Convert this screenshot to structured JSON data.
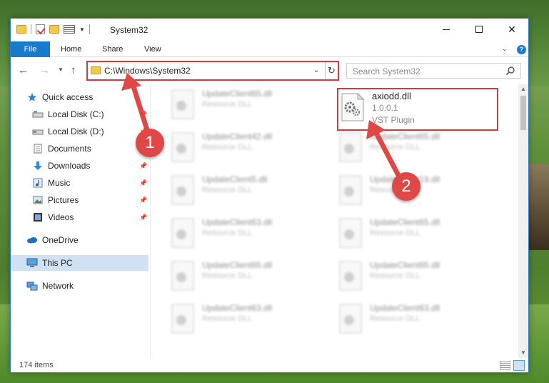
{
  "window": {
    "title": "System32",
    "min_label": "",
    "max_label": "",
    "close_label": "✕"
  },
  "ribbon": {
    "tabs": [
      "File",
      "Home",
      "Share",
      "View"
    ]
  },
  "address": {
    "path": "C:\\Windows\\System32",
    "search_placeholder": "Search System32"
  },
  "sidebar": {
    "items": [
      {
        "label": "Quick access",
        "icon": "star-icon",
        "pinned": false
      },
      {
        "label": "Local Disk (C:)",
        "icon": "drive-icon",
        "pinned": true
      },
      {
        "label": "Local Disk (D:)",
        "icon": "drive-icon",
        "pinned": true
      },
      {
        "label": "Documents",
        "icon": "document-icon",
        "pinned": true
      },
      {
        "label": "Downloads",
        "icon": "download-icon",
        "pinned": true
      },
      {
        "label": "Music",
        "icon": "music-icon",
        "pinned": true
      },
      {
        "label": "Pictures",
        "icon": "pictures-icon",
        "pinned": true
      },
      {
        "label": "Videos",
        "icon": "video-icon",
        "pinned": true
      },
      {
        "label": "OneDrive",
        "icon": "cloud-icon",
        "pinned": false
      },
      {
        "label": "This PC",
        "icon": "computer-icon",
        "pinned": false
      },
      {
        "label": "Network",
        "icon": "network-icon",
        "pinned": false
      }
    ]
  },
  "files": {
    "left_column": [
      {
        "name": "UpdateClient65.dll",
        "type": "Resource DLL"
      },
      {
        "name": "UpdateClient42.dll",
        "type": "Resource DLL"
      },
      {
        "name": "UpdateClient5.dll",
        "type": "Resource DLL"
      },
      {
        "name": "UpdateClient63.dll",
        "type": "Resource DLL"
      },
      {
        "name": "UpdateClient65.dll",
        "type": "Resource DLL"
      },
      {
        "name": "UpdateClient63.dll",
        "type": "Resource DLL"
      }
    ],
    "right_column": [
      {
        "name": "UpdateClient65.dll",
        "type": "Resource DLL"
      },
      {
        "name": "UpdateClient19.dll",
        "type": "Resource DLL"
      },
      {
        "name": "UpdateClient65.dll",
        "type": "Resource DLL"
      },
      {
        "name": "UpdateClient65.dll",
        "type": "Resource DLL"
      },
      {
        "name": "UpdateClient63.dll",
        "type": "Resource DLL"
      }
    ],
    "highlighted": {
      "name": "axiodd.dll",
      "version": "1.0.0.1",
      "type": "VST Plugin"
    }
  },
  "status": {
    "item_count": "174 items"
  },
  "callouts": {
    "one": "1",
    "two": "2"
  },
  "colors": {
    "accent": "#1979ca",
    "highlight_red": "#d9363e",
    "selected_nav": "#cfe1f2"
  }
}
